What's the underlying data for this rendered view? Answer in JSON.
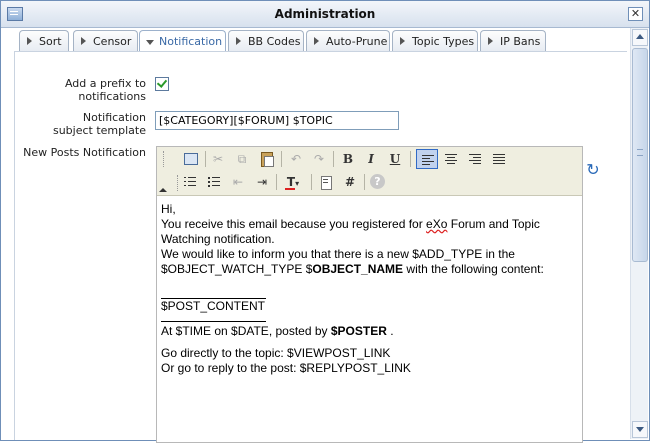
{
  "window": {
    "title": "Administration",
    "close_glyph": "✕"
  },
  "tabs": [
    {
      "label": "Sort",
      "active": false
    },
    {
      "label": "Censor",
      "active": false
    },
    {
      "label": "Notification",
      "active": true
    },
    {
      "label": "BB Codes",
      "active": false
    },
    {
      "label": "Auto-Prune",
      "active": false
    },
    {
      "label": "Topic Types",
      "active": false
    },
    {
      "label": "IP Bans",
      "active": false
    }
  ],
  "form": {
    "prefix_label": "Add a prefix to notifications",
    "prefix_checked": true,
    "subject_label": "Notification subject template",
    "subject_value": "[$CATEGORY][$FORUM] $TOPIC",
    "new_posts_label": "New Posts Notification"
  },
  "toolbar": {
    "row1": [
      "source-icon",
      "cut-icon",
      "copy-icon",
      "paste-icon",
      "undo-icon",
      "redo-icon",
      "bold-icon",
      "italic-icon",
      "underline-icon",
      "align-left-icon",
      "align-center-icon",
      "align-right-icon",
      "justify-icon"
    ],
    "row2": [
      "numbered-list-icon",
      "bulleted-list-icon",
      "outdent-icon",
      "indent-icon",
      "text-color-icon",
      "paste-text-icon",
      "hash-icon",
      "help-icon"
    ],
    "bold": "B",
    "italic": "I",
    "underline": "U",
    "hash": "#",
    "help": "?",
    "text_color": "T"
  },
  "editor": {
    "line1": "Hi,",
    "line2a": "You receive this email because you registered for ",
    "line2b": "eXo",
    "line2c": " Forum and Topic Watching notification.",
    "line3a": "We would like to inform you that there is a new $ADD_TYPE in the $OBJECT_WATCH_TYPE $",
    "line3b": "OBJECT_NAME",
    "line3c": " with the following content:",
    "post_content": "$POST_CONTENT",
    "time_a": "At $TIME on $DATE, posted by ",
    "time_b": "$POSTER",
    "time_c": " .",
    "goto_topic": "Go directly to the topic: $VIEWPOST_LINK",
    "goto_reply": "Or go to reply to the post: $REPLYPOST_LINK"
  },
  "reload_glyph": "↻"
}
